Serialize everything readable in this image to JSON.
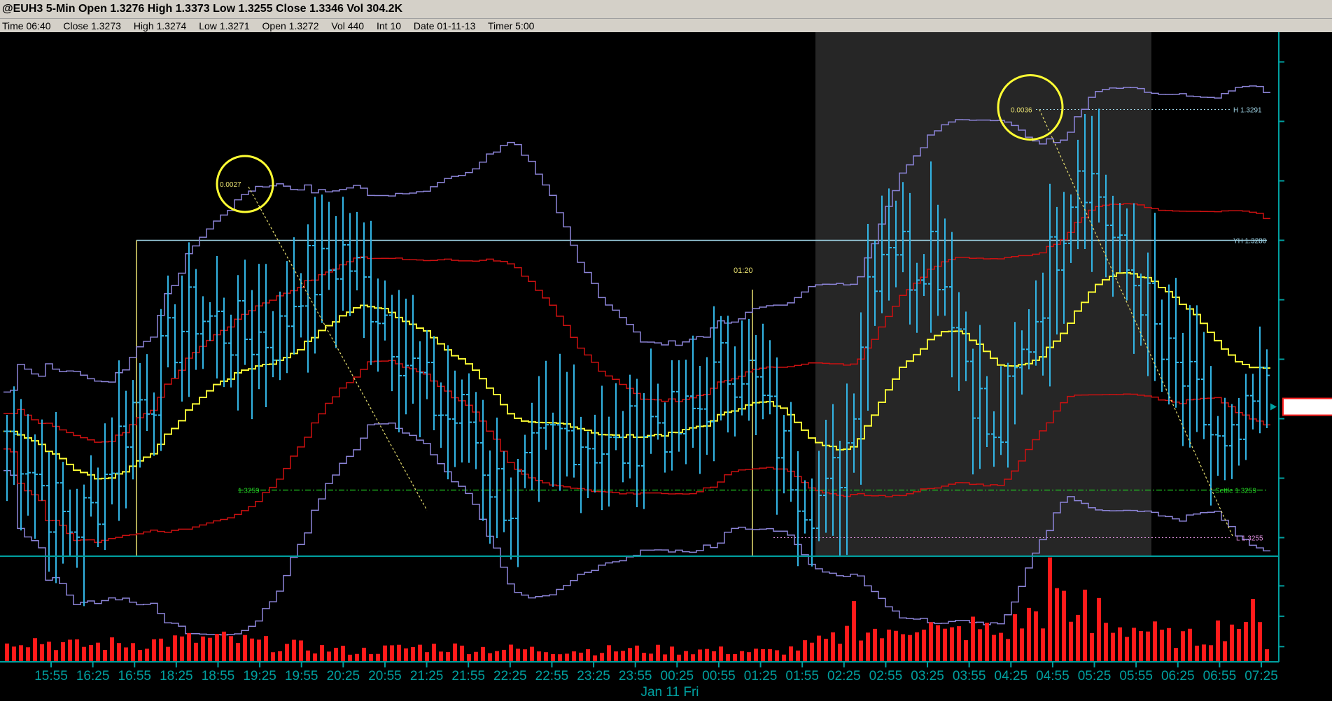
{
  "title_bar": {
    "symbol": "@EUH3",
    "interval": "5-Min",
    "open_label": "Open",
    "open_value": "1.3276",
    "high_label": "High",
    "high_value": "1.3373",
    "low_label": "Low",
    "low_value": "1.3255",
    "close_label": "Close",
    "close_value": "1.3346",
    "vol_label": "Vol",
    "vol_value": "304.2K"
  },
  "info_bar": {
    "time": "Time 06:40",
    "close": "Close 1.3273",
    "high": "High 1.3274",
    "low": "Low 1.3271",
    "open": "Open 1.3272",
    "vol": "Vol 440",
    "int": "Int 10",
    "date": "Date 01-11-13",
    "timer": "Timer 5:00"
  },
  "colors": {
    "background": "#000000",
    "bars": "#33b5e5",
    "axis": "#00a0a0",
    "session_shade": "#262626",
    "upper_band": "#8c84d8",
    "middle_red": "#cc1111",
    "ma_yellow": "#ffff33",
    "volume": "#ff1a1a",
    "settle_line": "#22cc22",
    "current_price_box": "#ff2020"
  },
  "chart_data": {
    "type": "ohlc",
    "price_axis": {
      "ylim": [
        1.32535,
        1.32975
      ],
      "ticks": [
        "1.3295",
        "1.3290",
        "1.3285",
        "1.3280",
        "1.3275",
        "1.3270",
        "1.3265",
        "1.3260",
        "1.3255"
      ]
    },
    "volume_axis": {
      "ylim": [
        0,
        2800
      ],
      "ticks": [
        "2000",
        "1200",
        "400"
      ]
    },
    "x_ticks": [
      "15:55",
      "16:25",
      "16:55",
      "18:25",
      "18:55",
      "19:25",
      "19:55",
      "20:25",
      "20:55",
      "21:25",
      "21:55",
      "22:25",
      "22:55",
      "23:25",
      "23:55",
      "00:25",
      "00:55",
      "01:25",
      "01:55",
      "02:25",
      "02:55",
      "03:25",
      "03:55",
      "04:25",
      "04:55",
      "05:25",
      "05:55",
      "06:25",
      "06:55",
      "07:25"
    ],
    "date_label": "Jan 11 Fri",
    "current_price": "1.3266",
    "levels": {
      "high": {
        "label": "H 1.3291",
        "value": 1.3291
      },
      "yesterday_high": {
        "label": "YH 1.3280",
        "value": 1.328
      },
      "settle": {
        "label": "Settle 1.3259",
        "left_label": "1.3259",
        "value": 1.3259
      },
      "low": {
        "label": "L 1.3255",
        "value": 1.3255
      }
    },
    "annotations": [
      {
        "text": "0.0027",
        "value": 1.32845
      },
      {
        "text": "0.0036",
        "value": 1.3291
      },
      {
        "text": "01:20",
        "value": 1.32775
      }
    ],
    "ohlc_keypoints": [
      [
        0,
        1.3264
      ],
      [
        3,
        1.3262
      ],
      [
        6,
        1.3258
      ],
      [
        9,
        1.3256
      ],
      [
        12,
        1.3257
      ],
      [
        15,
        1.3262
      ],
      [
        18,
        1.3266
      ],
      [
        21,
        1.3268
      ],
      [
        24,
        1.3272
      ],
      [
        27,
        1.3274
      ],
      [
        30,
        1.3273
      ],
      [
        33,
        1.3272
      ],
      [
        36,
        1.3272
      ],
      [
        39,
        1.3272
      ],
      [
        42,
        1.3277
      ],
      [
        45,
        1.3277
      ],
      [
        48,
        1.3279
      ],
      [
        51,
        1.3276
      ],
      [
        54,
        1.3274
      ],
      [
        57,
        1.327
      ],
      [
        60,
        1.3267
      ],
      [
        63,
        1.3265
      ],
      [
        66,
        1.3265
      ],
      [
        69,
        1.326
      ],
      [
        72,
        1.3258
      ],
      [
        75,
        1.3261
      ],
      [
        78,
        1.3263
      ],
      [
        81,
        1.3264
      ],
      [
        84,
        1.3263
      ],
      [
        87,
        1.3262
      ],
      [
        90,
        1.3264
      ],
      [
        93,
        1.3265
      ],
      [
        96,
        1.3264
      ],
      [
        99,
        1.3266
      ],
      [
        102,
        1.3269
      ],
      [
        105,
        1.327
      ],
      [
        108,
        1.3266
      ],
      [
        111,
        1.3262
      ],
      [
        114,
        1.3259
      ],
      [
        117,
        1.3258
      ],
      [
        120,
        1.3263
      ],
      [
        123,
        1.3277
      ],
      [
        126,
        1.3281
      ],
      [
        129,
        1.3278
      ],
      [
        132,
        1.328
      ],
      [
        135,
        1.3275
      ],
      [
        138,
        1.3268
      ],
      [
        141,
        1.3262
      ],
      [
        144,
        1.3268
      ],
      [
        147,
        1.3274
      ],
      [
        150,
        1.328
      ],
      [
        153,
        1.3287
      ],
      [
        156,
        1.3284
      ],
      [
        159,
        1.3278
      ],
      [
        162,
        1.3276
      ],
      [
        165,
        1.327
      ],
      [
        168,
        1.3268
      ],
      [
        171,
        1.3265
      ],
      [
        174,
        1.3261
      ],
      [
        177,
        1.3264
      ],
      [
        180,
        1.3269
      ]
    ],
    "volume_keypoints": [
      [
        0,
        680
      ],
      [
        10,
        420
      ],
      [
        20,
        520
      ],
      [
        30,
        600
      ],
      [
        40,
        420
      ],
      [
        50,
        280
      ],
      [
        60,
        400
      ],
      [
        70,
        340
      ],
      [
        80,
        300
      ],
      [
        90,
        320
      ],
      [
        100,
        300
      ],
      [
        110,
        260
      ],
      [
        118,
        560
      ],
      [
        122,
        980
      ],
      [
        126,
        640
      ],
      [
        130,
        1150
      ],
      [
        134,
        700
      ],
      [
        138,
        900
      ],
      [
        142,
        720
      ],
      [
        146,
        1200
      ],
      [
        150,
        1550
      ],
      [
        154,
        760
      ],
      [
        158,
        980
      ],
      [
        162,
        880
      ],
      [
        166,
        640
      ],
      [
        170,
        600
      ],
      [
        174,
        950
      ],
      [
        178,
        1180
      ],
      [
        180,
        520
      ]
    ],
    "spikes": [
      {
        "bar": 121,
        "volume": 1600
      },
      {
        "bar": 149,
        "volume": 2750
      },
      {
        "bar": 154,
        "volume": 1900
      },
      {
        "bar": 156,
        "volume": 1680
      },
      {
        "bar": 177,
        "volume": 1050
      }
    ]
  }
}
